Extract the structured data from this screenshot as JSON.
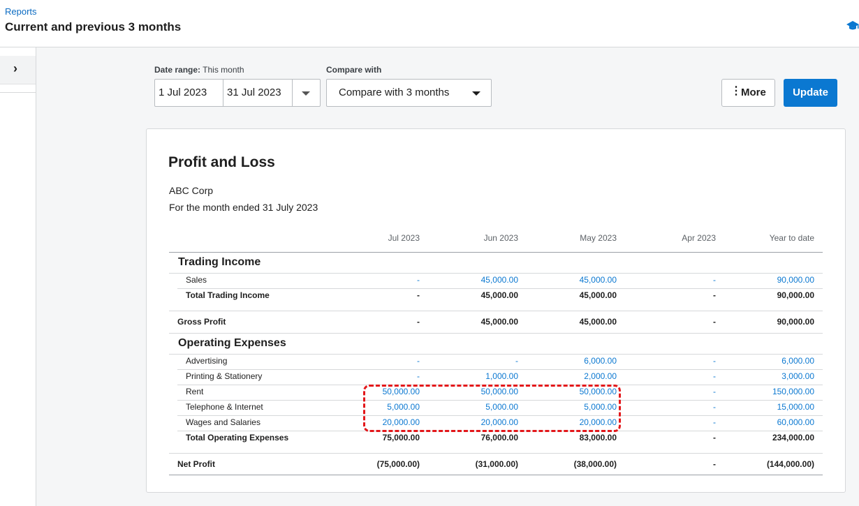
{
  "header": {
    "breadcrumb": "Reports",
    "title": "Current and previous 3 months"
  },
  "icons": {
    "help": "graduation-cap-icon",
    "expand": "chevron-right-icon",
    "more": "vertical-ellipsis-icon",
    "dropdown": "caret-down-icon"
  },
  "filters": {
    "date_range_label": "Date range:",
    "date_range_value": "This month",
    "start_date": "1 Jul 2023",
    "end_date": "31 Jul 2023",
    "compare_label": "Compare with",
    "compare_value": "Compare with 3 months",
    "more_label": "More",
    "update_label": "Update"
  },
  "colors": {
    "accent": "#0b78d1",
    "highlight": "#e3171a"
  },
  "report": {
    "title": "Profit and Loss",
    "company": "ABC Corp",
    "period": "For the month ended 31 July 2023",
    "columns": [
      "Jul 2023",
      "Jun 2023",
      "May 2023",
      "Apr 2023",
      "Year to date"
    ],
    "sections": [
      {
        "title": "Trading Income",
        "rows": [
          {
            "label": "Sales",
            "values": [
              "-",
              "45,000.00",
              "45,000.00",
              "-",
              "90,000.00"
            ]
          }
        ],
        "total": {
          "label": "Total Trading Income",
          "values": [
            "-",
            "45,000.00",
            "45,000.00",
            "-",
            "90,000.00"
          ]
        }
      },
      {
        "title": "Operating Expenses",
        "rows": [
          {
            "label": "Advertising",
            "values": [
              "-",
              "-",
              "6,000.00",
              "-",
              "6,000.00"
            ]
          },
          {
            "label": "Printing & Stationery",
            "values": [
              "-",
              "1,000.00",
              "2,000.00",
              "-",
              "3,000.00"
            ]
          },
          {
            "label": "Rent",
            "values": [
              "50,000.00",
              "50,000.00",
              "50,000.00",
              "-",
              "150,000.00"
            ]
          },
          {
            "label": "Telephone & Internet",
            "values": [
              "5,000.00",
              "5,000.00",
              "5,000.00",
              "-",
              "15,000.00"
            ]
          },
          {
            "label": "Wages and Salaries",
            "values": [
              "20,000.00",
              "20,000.00",
              "20,000.00",
              "-",
              "60,000.00"
            ]
          }
        ],
        "total": {
          "label": "Total Operating Expenses",
          "values": [
            "75,000.00",
            "76,000.00",
            "83,000.00",
            "-",
            "234,000.00"
          ]
        }
      }
    ],
    "gross_profit": {
      "label": "Gross Profit",
      "values": [
        "-",
        "45,000.00",
        "45,000.00",
        "-",
        "90,000.00"
      ]
    },
    "net_profit": {
      "label": "Net Profit",
      "values": [
        "(75,000.00)",
        "(31,000.00)",
        "(38,000.00)",
        "-",
        "(144,000.00)"
      ]
    }
  }
}
